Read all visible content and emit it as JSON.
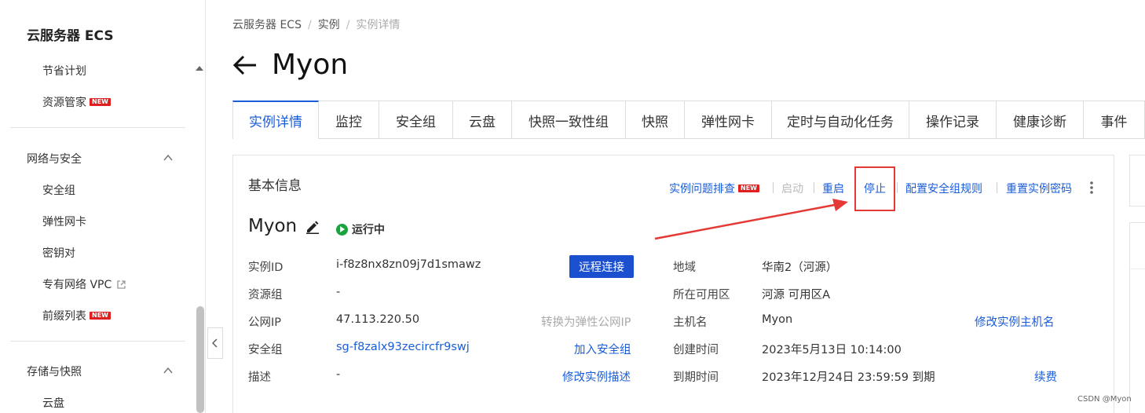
{
  "sidebar": {
    "title": "云服务器 ECS",
    "items_top": [
      {
        "label": "节省计划"
      },
      {
        "label": "资源管家",
        "badge": "NEW"
      }
    ],
    "network_group": "网络与安全",
    "network_items": [
      {
        "label": "安全组"
      },
      {
        "label": "弹性网卡"
      },
      {
        "label": "密钥对"
      },
      {
        "label": "专有网络 VPC"
      },
      {
        "label": "前缀列表",
        "badge": "NEW"
      }
    ],
    "storage_group": "存储与快照",
    "storage_items": [
      {
        "label": "云盘"
      }
    ]
  },
  "breadcrumb": [
    "云服务器 ECS",
    "实例",
    "实例详情"
  ],
  "page_title": "Myon",
  "tabs": [
    "实例详情",
    "监控",
    "安全组",
    "云盘",
    "快照一致性组",
    "快照",
    "弹性网卡",
    "定时与自动化任务",
    "操作记录",
    "健康诊断",
    "事件"
  ],
  "active_tab": "实例详情",
  "basic_info": {
    "title": "基本信息",
    "actions": {
      "troubleshoot": "实例问题排查",
      "troubleshoot_badge": "NEW",
      "start": "启动",
      "restart": "重启",
      "stop": "停止",
      "config_sg": "配置安全组规则",
      "reset_pwd": "重置实例密码"
    },
    "instance_name": "Myon",
    "status": "运行中",
    "status_color": "#1aa33f",
    "left": {
      "instance_id_label": "实例ID",
      "instance_id": "i-f8z8nx8zn09j7d1smawz",
      "remote_connect": "远程连接",
      "resource_group_label": "资源组",
      "resource_group": "-",
      "public_ip_label": "公网IP",
      "public_ip": "47.113.220.50",
      "convert_eip": "转换为弹性公网IP",
      "security_group_label": "安全组",
      "security_group": "sg-f8zalx93zecircfr9swj",
      "join_sg": "加入安全组",
      "description_label": "描述",
      "description": "-",
      "edit_description": "修改实例描述"
    },
    "right": {
      "region_label": "地域",
      "region": "华南2（河源）",
      "zone_label": "所在可用区",
      "zone": "河源 可用区A",
      "hostname_label": "主机名",
      "hostname": "Myon",
      "edit_hostname": "修改实例主机名",
      "created_label": "创建时间",
      "created": "2023年5月13日 10:14:00",
      "expire_label": "到期时间",
      "expire": "2023年12月24日 23:59:59 到期",
      "renew": "续费"
    }
  },
  "annotation_color": "#e53935",
  "watermark": "CSDN @Myon⁠"
}
